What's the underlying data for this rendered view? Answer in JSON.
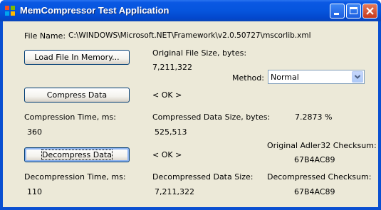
{
  "window": {
    "title": "MemCompressor Test Application"
  },
  "file": {
    "name_label": "File Name:",
    "path": "C:\\WINDOWS\\Microsoft.NET\\Framework\\v2.0.50727\\mscorlib.xml"
  },
  "buttons": {
    "load": "Load File In Memory...",
    "compress": "Compress Data",
    "decompress": "Decompress Data"
  },
  "original": {
    "size_label": "Original File Size, bytes:",
    "size_value": "7,211,322"
  },
  "method": {
    "label": "Method:",
    "selected": "Normal"
  },
  "compress_status": "< OK >",
  "decompress_status": "< OK >",
  "compression": {
    "time_label": "Compression Time, ms:",
    "time_value": "360",
    "size_label": "Compressed Data Size, bytes:",
    "size_value": "525,513",
    "ratio": "7.2873 %"
  },
  "adler": {
    "label": "Original Adler32 Checksum:",
    "value": "67B4AC89"
  },
  "decompression": {
    "time_label": "Decompression Time, ms:",
    "time_value": "110",
    "size_label": "Decompressed Data Size:",
    "size_value": "7,211,322",
    "checksum_label": "Decompressed Checksum:",
    "checksum_value": "67B4AC89"
  },
  "colors": {
    "titlebar": "#0655dd",
    "client": "#ece9d8",
    "close_button": "#c8391c"
  }
}
